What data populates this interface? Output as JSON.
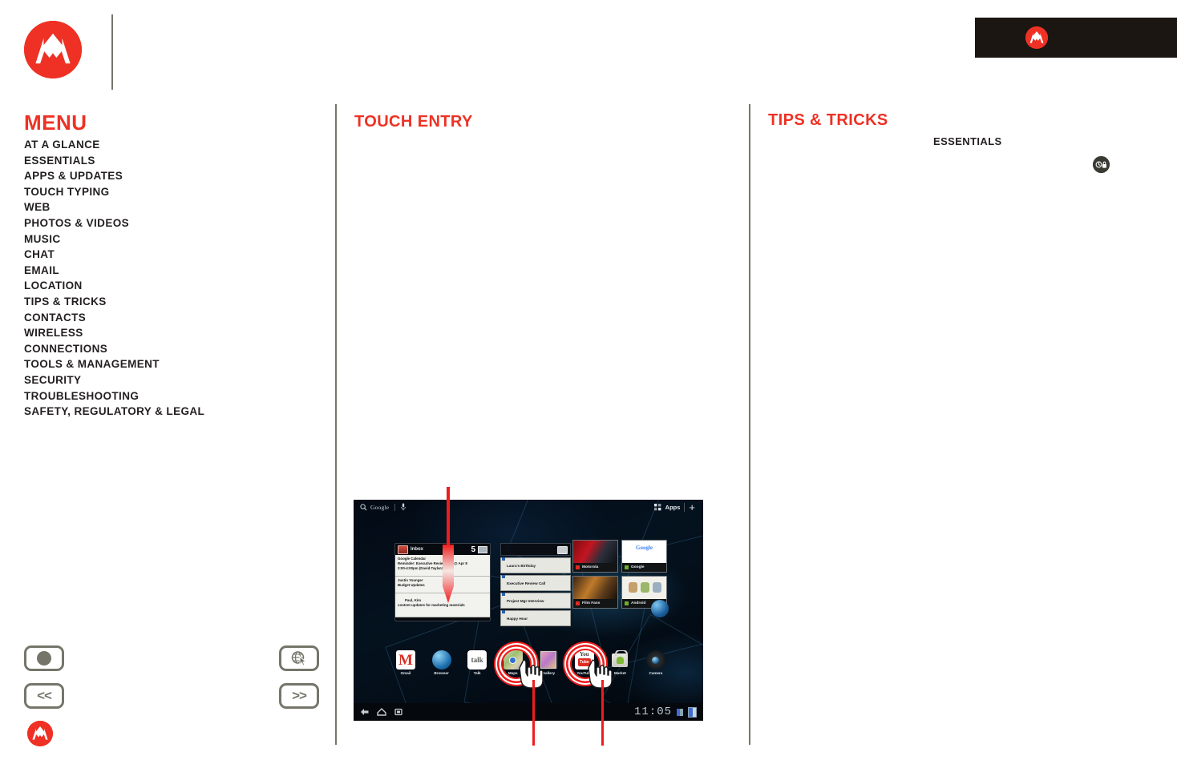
{
  "brand": {
    "name": "Motorola",
    "logo_color": "#ee3124",
    "badge_bg": "#1c1613"
  },
  "menu": {
    "title": "MENU",
    "items": [
      {
        "label": "AT A GLANCE"
      },
      {
        "label": "ESSENTIALS"
      },
      {
        "label": "APPS & UPDATES"
      },
      {
        "label": "TOUCH TYPING"
      },
      {
        "label": "WEB"
      },
      {
        "label": "PHOTOS & VIDEOS"
      },
      {
        "label": "MUSIC"
      },
      {
        "label": "CHAT"
      },
      {
        "label": "EMAIL"
      },
      {
        "label": "LOCATION"
      },
      {
        "label": "TIPS & TRICKS"
      },
      {
        "label": "CONTACTS"
      },
      {
        "label": "WIRELESS"
      },
      {
        "label": "CONNECTIONS"
      },
      {
        "label": "TOOLS & MANAGEMENT"
      },
      {
        "label": "SECURITY"
      },
      {
        "label": "TROUBLESHOOTING"
      },
      {
        "label": "SAFETY, REGULATORY & LEGAL"
      }
    ]
  },
  "main": {
    "heading": "TOUCH ENTRY"
  },
  "tips": {
    "heading": "TIPS & TRICKS",
    "essentials_label": "ESSENTIALS",
    "badge_icon": "clock-lock-icon"
  },
  "nav": {
    "home": {
      "icon": "home-dot-icon",
      "label": ""
    },
    "prev": {
      "icon": "previous-icon",
      "label": "<<"
    },
    "web": {
      "icon": "globe-cursor-icon",
      "label": ""
    },
    "next": {
      "icon": "next-icon",
      "label": ">>"
    }
  },
  "tablet": {
    "search": {
      "provider": "Google",
      "mic_icon": "microphone-icon",
      "search_icon": "search-icon"
    },
    "apps_label": "Apps",
    "add_icon": "plus-icon",
    "email_widget": {
      "title": "Inbox",
      "icon": "email-icon",
      "unread_count": "5",
      "envelope_icon": "envelope-icon",
      "messages": [
        {
          "from": "Google Calendar",
          "subject": "Reminder: Executive Review Call @ Apr 8",
          "detail": "3:00-4:00pm (David.Taylar@moto"
        },
        {
          "from": "Justin Younger",
          "subject": "Budget Updates",
          "detail": ""
        },
        {
          "from": "Paul, Kim",
          "subject": "content updates for marketing materials",
          "detail": ""
        }
      ]
    },
    "calendar_widget": {
      "icon": "calendar-icon",
      "events": [
        {
          "title": "Laura's Birthday"
        },
        {
          "title": "Executive Review Call"
        },
        {
          "title": "Project Mgr Interview"
        },
        {
          "title": "Happy Hour"
        }
      ]
    },
    "bookmarks": [
      {
        "label": "Motorola",
        "favicon": "red"
      },
      {
        "label": "Google",
        "favicon": "green"
      },
      {
        "label": "Film Fans",
        "favicon": "red"
      },
      {
        "label": "Android",
        "favicon": "green"
      }
    ],
    "dock": [
      {
        "label": "Gmail",
        "icon": "gmail-icon"
      },
      {
        "label": "Browser",
        "icon": "browser-icon"
      },
      {
        "label": "Talk",
        "icon": "talk-icon",
        "glyph": "talk"
      },
      {
        "label": "Maps",
        "icon": "maps-icon"
      },
      {
        "label": "Gallery",
        "icon": "gallery-icon"
      },
      {
        "label": "YouTube",
        "icon": "youtube-icon",
        "glyph_top": "You",
        "glyph_bottom": "Tube"
      },
      {
        "label": "Market",
        "icon": "market-icon"
      },
      {
        "label": "Camera",
        "icon": "camera-icon"
      }
    ],
    "system_bar": {
      "back_icon": "back-icon",
      "home_icon": "home-icon",
      "recents_icon": "recent-apps-icon",
      "clock": "11:05",
      "signal_icon": "signal-icon",
      "battery_icon": "battery-icon"
    },
    "annotations": {
      "arrow_color": "#ee1d1d",
      "touch_targets": [
        "Maps",
        "YouTube"
      ]
    }
  }
}
